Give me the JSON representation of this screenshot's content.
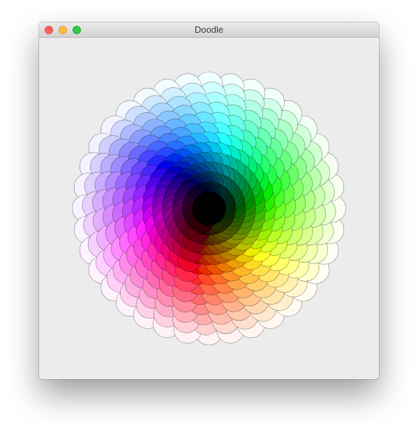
{
  "window": {
    "title": "Doodle",
    "controls": {
      "close": "close-button",
      "minimize": "minimize-button",
      "zoom": "zoom-button"
    }
  },
  "canvas": {
    "background": "#ececec",
    "stroke_color": "#000000",
    "ring_count": 13,
    "hue_steps": 36,
    "petal_rotation_deg": 20
  }
}
